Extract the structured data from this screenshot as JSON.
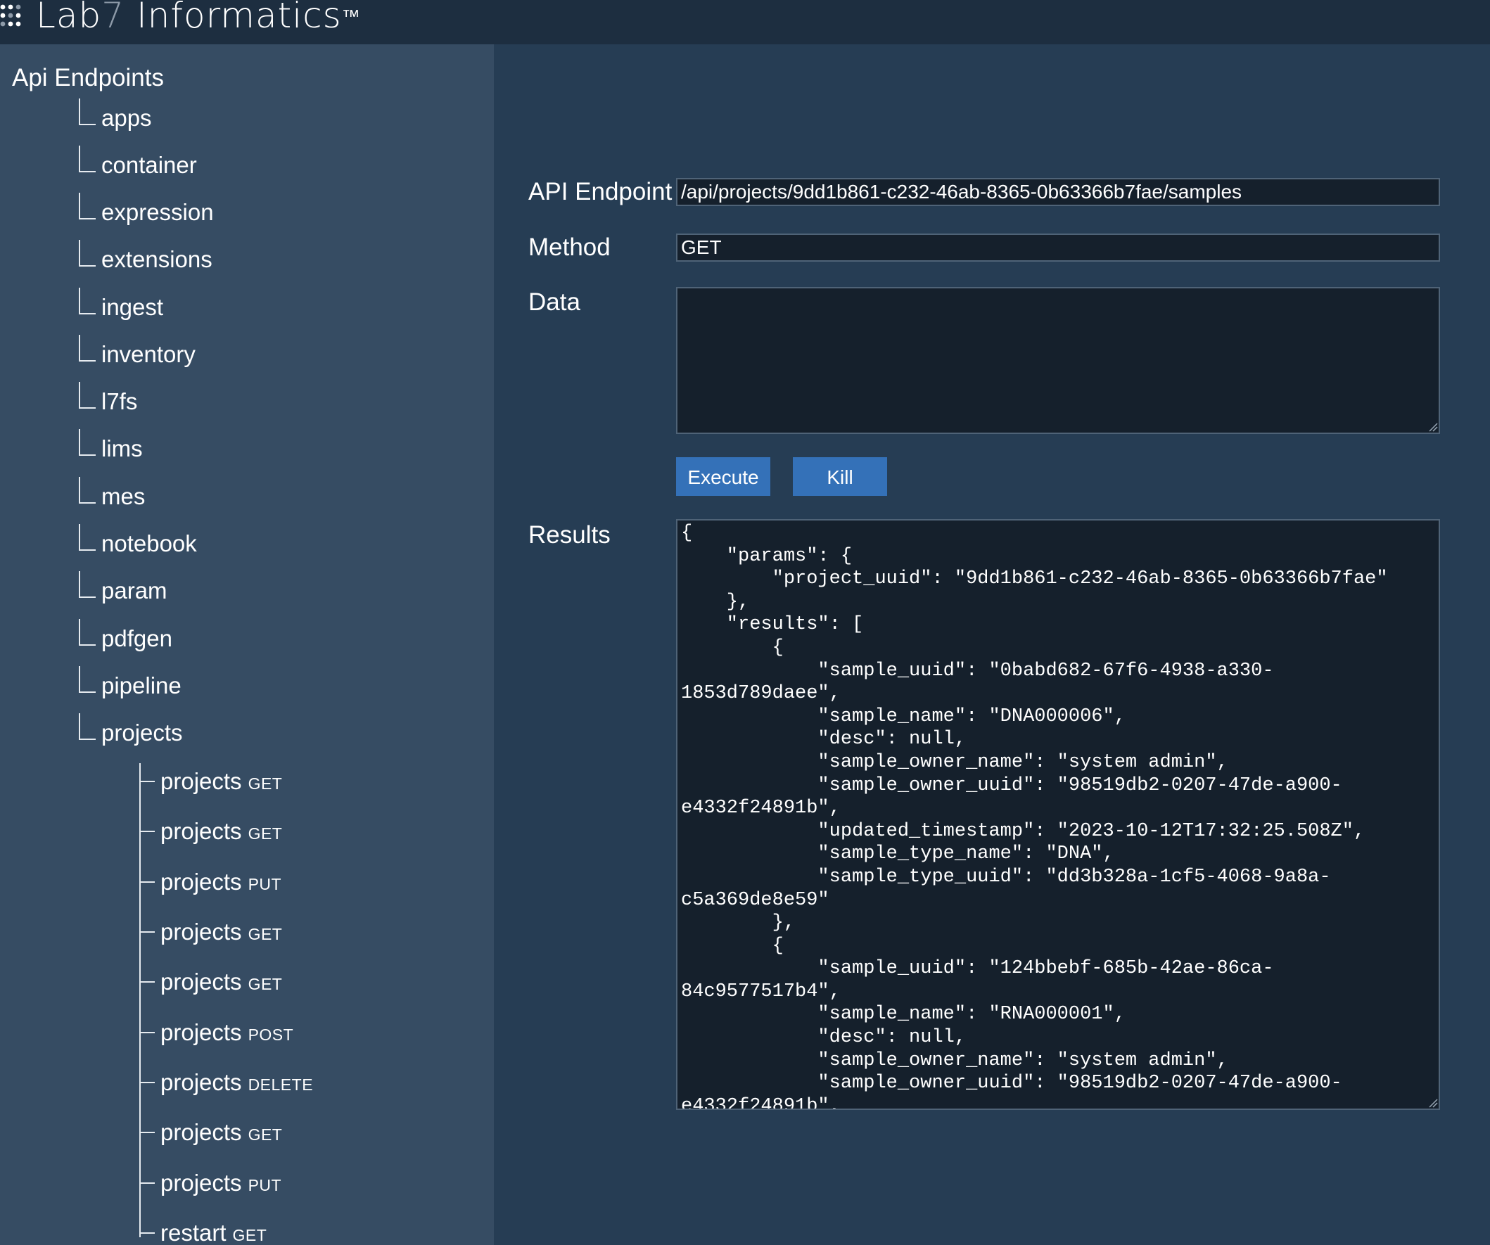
{
  "app": {
    "logo_lab": "Lab",
    "logo_seven": "7",
    "logo_informatics": " Informatics",
    "logo_tm": "™"
  },
  "sidebar": {
    "root_label": "Api Endpoints",
    "items": [
      {
        "label": "apps"
      },
      {
        "label": "container"
      },
      {
        "label": "expression"
      },
      {
        "label": "extensions"
      },
      {
        "label": "ingest"
      },
      {
        "label": "inventory"
      },
      {
        "label": "l7fs"
      },
      {
        "label": "lims"
      },
      {
        "label": "mes"
      },
      {
        "label": "notebook"
      },
      {
        "label": "param"
      },
      {
        "label": "pdfgen"
      },
      {
        "label": "pipeline"
      },
      {
        "label": "projects"
      }
    ],
    "project_children": [
      {
        "label": "projects",
        "method": "GET"
      },
      {
        "label": "projects",
        "method": "GET"
      },
      {
        "label": "projects",
        "method": "PUT"
      },
      {
        "label": "projects",
        "method": "GET"
      },
      {
        "label": "projects",
        "method": "GET"
      },
      {
        "label": "projects",
        "method": "POST"
      },
      {
        "label": "projects",
        "method": "DELETE"
      },
      {
        "label": "projects",
        "method": "GET"
      },
      {
        "label": "projects",
        "method": "PUT"
      },
      {
        "label": "restart",
        "method": "GET"
      }
    ]
  },
  "form": {
    "endpoint_label": "API Endpoint",
    "endpoint_value": "/api/projects/9dd1b861-c232-46ab-8365-0b63366b7fae/samples",
    "method_label": "Method",
    "method_value": "GET",
    "data_label": "Data",
    "data_value": "",
    "execute_label": "Execute",
    "kill_label": "Kill",
    "results_label": "Results",
    "results_text": "{\n    \"params\": {\n        \"project_uuid\": \"9dd1b861-c232-46ab-8365-0b63366b7fae\"\n    },\n    \"results\": [\n        {\n            \"sample_uuid\": \"0babd682-67f6-4938-a330-\n1853d789daee\",\n            \"sample_name\": \"DNA000006\",\n            \"desc\": null,\n            \"sample_owner_name\": \"system admin\",\n            \"sample_owner_uuid\": \"98519db2-0207-47de-a900-\ne4332f24891b\",\n            \"updated_timestamp\": \"2023-10-12T17:32:25.508Z\",\n            \"sample_type_name\": \"DNA\",\n            \"sample_type_uuid\": \"dd3b328a-1cf5-4068-9a8a-\nc5a369de8e59\"\n        },\n        {\n            \"sample_uuid\": \"124bbebf-685b-42ae-86ca-\n84c9577517b4\",\n            \"sample_name\": \"RNA000001\",\n            \"desc\": null,\n            \"sample_owner_name\": \"system admin\",\n            \"sample_owner_uuid\": \"98519db2-0207-47de-a900-\ne4332f24891b\","
  },
  "colors": {
    "header_bg": "#1d2e40",
    "sidebar_bg": "#364c63",
    "main_bg": "#263d54",
    "field_bg": "#15202c",
    "button_bg": "#3471b8",
    "logo_seven": "#8d9aa8"
  }
}
